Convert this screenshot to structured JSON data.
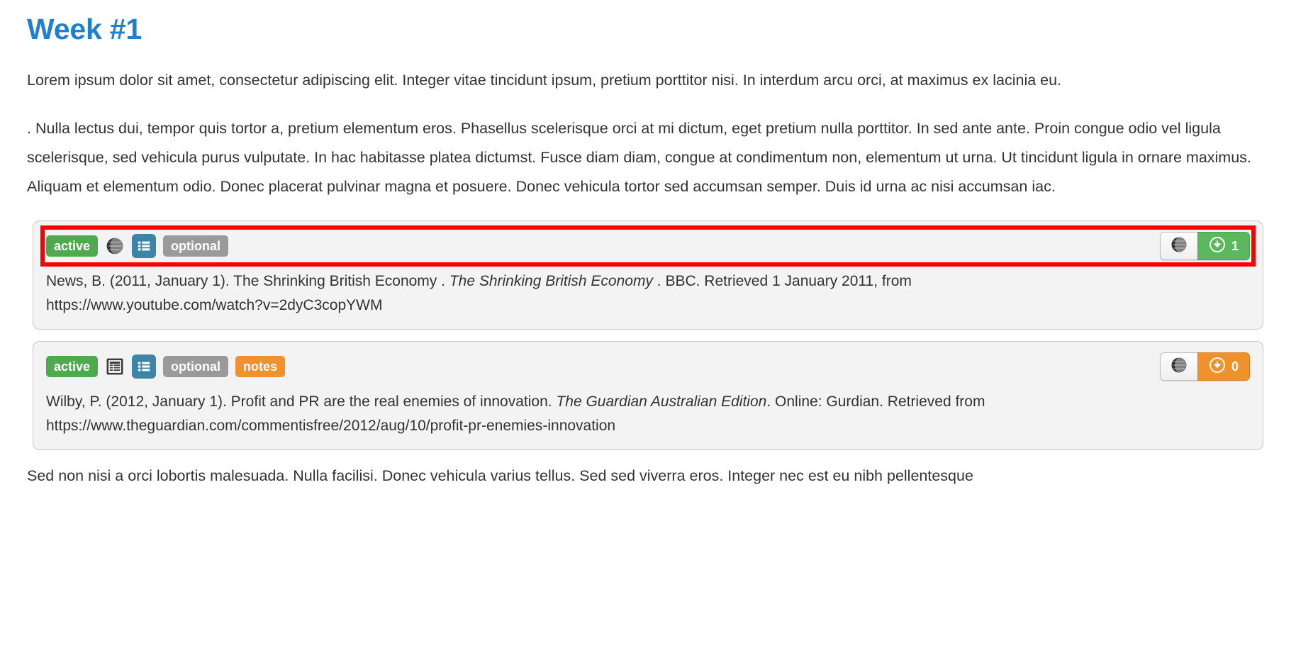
{
  "page": {
    "title": "Week #1"
  },
  "paragraphs": {
    "intro": "Lorem ipsum dolor sit amet, consectetur adipiscing elit. Integer vitae tincidunt ipsum, pretium porttitor nisi. In interdum arcu orci, at maximus ex lacinia eu.",
    "body": ". Nulla lectus dui, tempor quis tortor a, pretium elementum eros. Phasellus scelerisque orci at mi dictum, eget pretium nulla porttitor. In sed ante ante. Proin congue odio vel ligula scelerisque, sed vehicula purus vulputate. In hac habitasse platea dictumst. Fusce diam diam, congue at condimentum non, elementum ut urna. Ut tincidunt ligula in ornare maximus. Aliquam et elementum odio. Donec placerat pulvinar magna et posuere. Donec vehicula tortor sed accumsan semper. Duis id urna ac nisi accumsan iac.",
    "footer": "Sed non nisi a orci lobortis malesuada. Nulla facilisi. Donec vehicula varius tellus. Sed sed viverra eros. Integer nec est eu nibh pellentesque"
  },
  "colors": {
    "title_blue": "#1f7fd0",
    "badge_green": "#4fa94f",
    "badge_gray": "#9a9a9a",
    "badge_orange": "#f0922b",
    "icon_blue": "#3d85a8",
    "highlight_red": "#fc0000",
    "card_bg": "#f3f3f3"
  },
  "cards": [
    {
      "highlighted": true,
      "badges": [
        {
          "kind": "label",
          "text": "active",
          "style": "green",
          "icon": ""
        },
        {
          "kind": "icon",
          "text": "",
          "style": "plain",
          "icon": "globe-icon"
        },
        {
          "kind": "icon",
          "text": "",
          "style": "blue",
          "icon": "list-icon"
        },
        {
          "kind": "label",
          "text": "optional",
          "style": "gray",
          "icon": ""
        }
      ],
      "actions": {
        "globe_label": "",
        "globe_icon": "globe-icon",
        "count_icon": "download-icon",
        "count": "1",
        "count_style": "green"
      },
      "citation": {
        "pre": "News, B. (2011, January 1). The Shrinking British Economy . ",
        "italic": "The Shrinking British Economy",
        "post": " . BBC. Retrieved 1 January 2011, from",
        "url": "https://www.youtube.com/watch?v=2dyC3copYWM"
      }
    },
    {
      "highlighted": false,
      "badges": [
        {
          "kind": "label",
          "text": "active",
          "style": "green",
          "icon": ""
        },
        {
          "kind": "icon",
          "text": "",
          "style": "plain",
          "icon": "document-icon"
        },
        {
          "kind": "icon",
          "text": "",
          "style": "blue",
          "icon": "list-icon"
        },
        {
          "kind": "label",
          "text": "optional",
          "style": "gray",
          "icon": ""
        },
        {
          "kind": "label",
          "text": "notes",
          "style": "orange",
          "icon": ""
        }
      ],
      "actions": {
        "globe_label": "",
        "globe_icon": "globe-icon",
        "count_icon": "download-icon",
        "count": "0",
        "count_style": "orange"
      },
      "citation": {
        "pre": "Wilby, P. (2012, January 1). Profit and PR are the real enemies of innovation. ",
        "italic": "The Guardian Australian Edition",
        "post": ". Online: Gurdian. Retrieved from",
        "url": "https://www.theguardian.com/commentisfree/2012/aug/10/profit-pr-enemies-innovation"
      }
    }
  ]
}
